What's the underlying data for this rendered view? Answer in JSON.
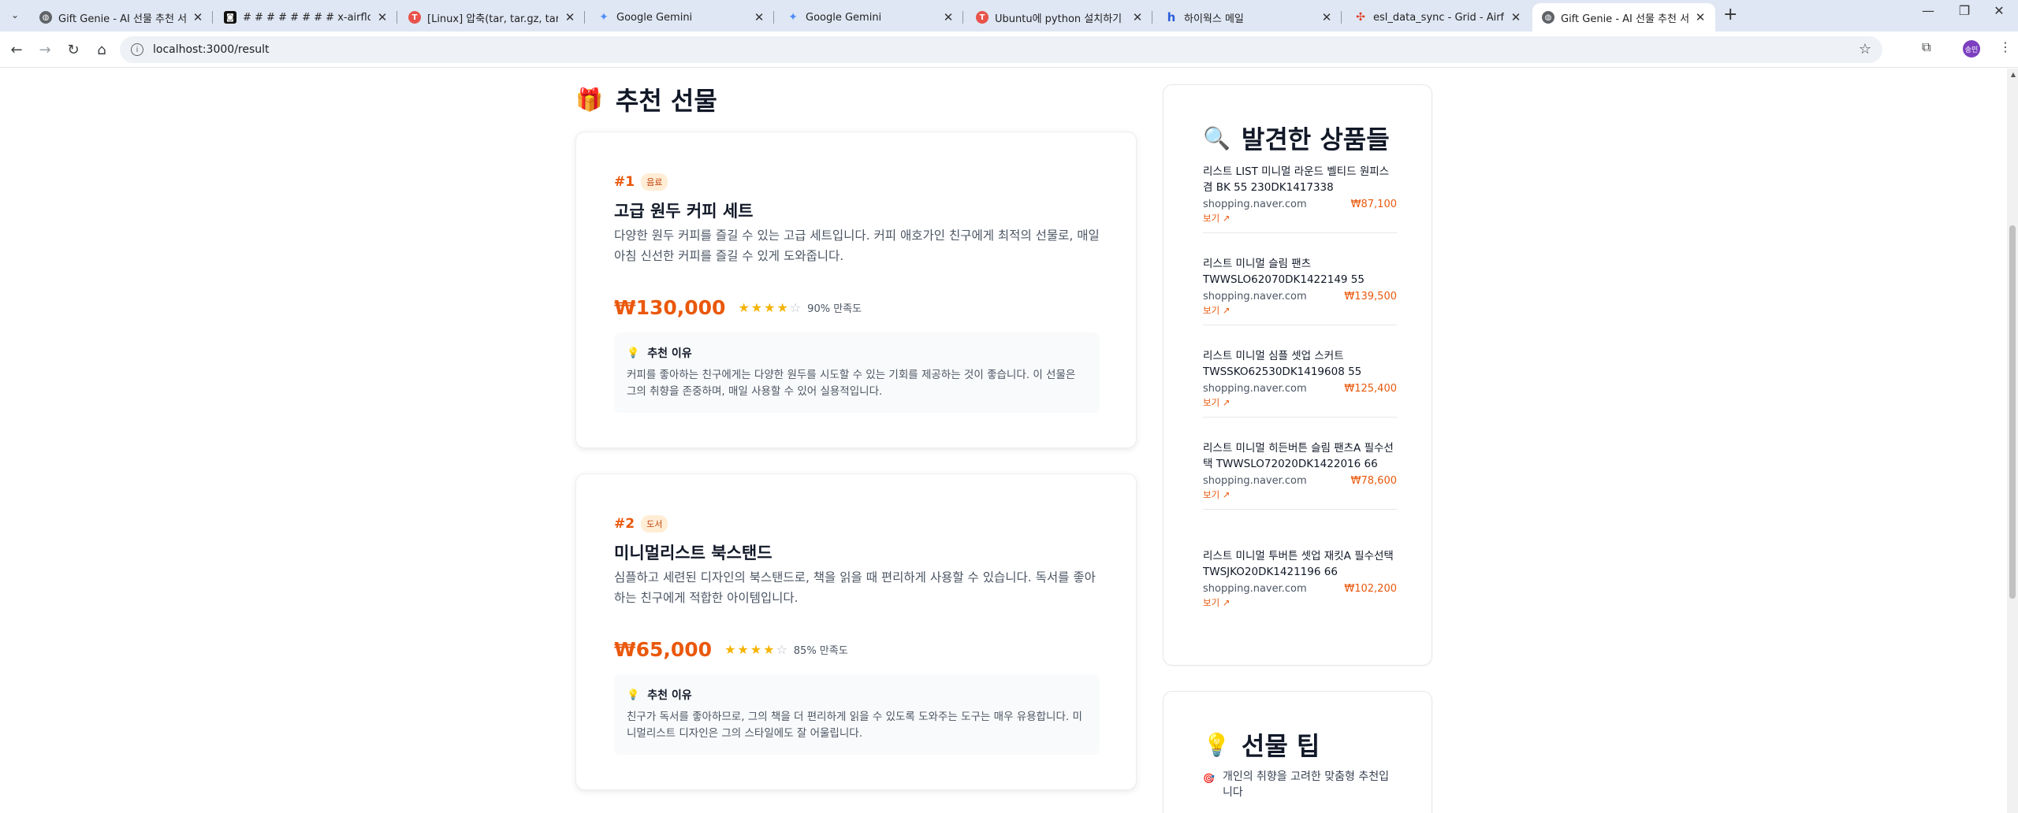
{
  "browser": {
    "tabs": [
      {
        "title": "Gift Genie - AI 선물 추천 서비스",
        "favicon": "globe-icon",
        "fav_color": "#5f6368",
        "fav_glyph": "◍"
      },
      {
        "title": "# # # # # # # # x-airflow-com",
        "favicon": "code-icon",
        "fav_color": "#111111",
        "fav_glyph": "◙"
      },
      {
        "title": "[Linux] 압축(tar, tar.gz, tar.xz) ",
        "favicon": "tistory-icon",
        "fav_color": "#e8534b",
        "fav_glyph": "T"
      },
      {
        "title": "Google Gemini",
        "favicon": "gemini-icon",
        "fav_color": "#4f8cf7",
        "fav_glyph": "✦"
      },
      {
        "title": "Google Gemini",
        "favicon": "gemini-icon",
        "fav_color": "#4f8cf7",
        "fav_glyph": "✦"
      },
      {
        "title": "Ubuntu에 python 설치하기",
        "favicon": "tistory-icon",
        "fav_color": "#e8534b",
        "fav_glyph": "T"
      },
      {
        "title": "하이웍스 메일",
        "favicon": "hiworks-icon",
        "fav_color": "#2b5fd9",
        "fav_glyph": "h"
      },
      {
        "title": "esl_data_sync - Grid - Airflow",
        "favicon": "airflow-icon",
        "fav_color": "#e43921",
        "fav_glyph": "✣"
      },
      {
        "title": "Gift Genie - AI 선물 추천 서비스",
        "favicon": "globe-icon",
        "fav_color": "#5f6368",
        "fav_glyph": "◍"
      }
    ],
    "url": "localhost:3000/result"
  },
  "recommendations": {
    "section_title": "추천 선물",
    "items": [
      {
        "rank": "#1",
        "category": "음료",
        "name": "고급 원두 커피 세트",
        "description": "다양한 원두 커피를 즐길 수 있는 고급 세트입니다. 커피 애호가인 친구에게 최적의 선물로, 매일 아침 신선한 커피를 즐길 수 있게 도와줍니다.",
        "price": "₩130,000",
        "rating": 4,
        "rating_max": 5,
        "satisfaction": "90% 만족도",
        "reason_label": "추천 이유",
        "reason": "커피를 좋아하는 친구에게는 다양한 원두를 시도할 수 있는 기회를 제공하는 것이 좋습니다. 이 선물은 그의 취향을 존중하며, 매일 사용할 수 있어 실용적입니다."
      },
      {
        "rank": "#2",
        "category": "도서",
        "name": "미니멀리스트 북스탠드",
        "description": "심플하고 세련된 디자인의 북스탠드로, 책을 읽을 때 편리하게 사용할 수 있습니다. 독서를 좋아하는 친구에게 적합한 아이템입니다.",
        "price": "₩65,000",
        "rating": 4,
        "rating_max": 5,
        "satisfaction": "85% 만족도",
        "reason_label": "추천 이유",
        "reason": "친구가 독서를 좋아하므로, 그의 책을 더 편리하게 읽을 수 있도록 도와주는 도구는 매우 유용합니다. 미니멀리스트 디자인은 그의 스타일에도 잘 어울립니다."
      }
    ]
  },
  "found_products": {
    "title": "발견한 상품들",
    "view_label": "보기",
    "items": [
      {
        "name": "리스트 LIST 미니멀 라운드 벨티드 원피스 겸 BK 55 230DK1417338",
        "shop": "shopping.naver.com",
        "price": "₩87,100"
      },
      {
        "name": "리스트 미니멀 슬림 팬츠 TWWSLO62070DK1422149 55",
        "shop": "shopping.naver.com",
        "price": "₩139,500"
      },
      {
        "name": "리스트 미니멀 심플 셋업 스커트 TWSSKO62530DK1419608 55",
        "shop": "shopping.naver.com",
        "price": "₩125,400"
      },
      {
        "name": "리스트 미니멀 히든버튼 슬림 팬츠A 필수선택 TWWSLO72020DK1422016 66",
        "shop": "shopping.naver.com",
        "price": "₩78,600"
      },
      {
        "name": "리스트 미니멀 투버튼 셋업 재킷A 필수선택 TWSJKO20DK1421196 66",
        "shop": "shopping.naver.com",
        "price": "₩102,200"
      }
    ]
  },
  "gift_tips": {
    "title": "선물 팁",
    "items": [
      "개인의 취향을 고려한 맞춤형 추천입니다"
    ]
  },
  "colors": {
    "accent": "#ea580c",
    "accent_soft": "#ffedd5",
    "star": "#f5b301"
  }
}
